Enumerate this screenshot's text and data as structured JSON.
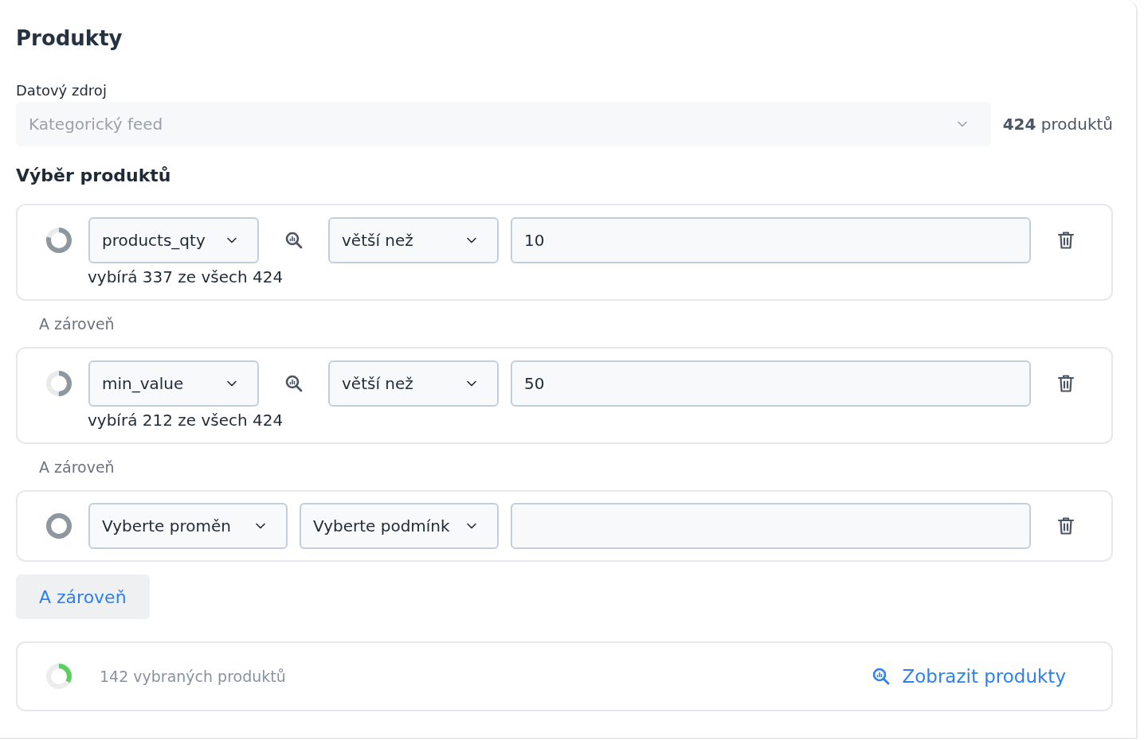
{
  "title": "Produkty",
  "data_source": {
    "label": "Datový zdroj",
    "placeholder": "Kategorický feed",
    "count": "**424** produktů"
  },
  "selection": {
    "heading": "Výběr produktů",
    "conditions": [
      {
        "kind": "defined",
        "level": 0.79,
        "variable": "products_qty",
        "operator": "větší než",
        "value": "10",
        "summary": "vybírá 337 ze všech 424"
      },
      {
        "kind": "defined",
        "level": 0.5,
        "variable": "min_value",
        "operator": "větší než",
        "value": "50",
        "summary": "vybírá 212 ze všech 424"
      },
      {
        "kind": "new",
        "level": 1,
        "variable": "Vyberte proměn",
        "operator": "Vyberte podmínk"
      }
    ],
    "connectors": [
      "A zároveň",
      "A zároveň"
    ],
    "add_button": "A zároveň"
  },
  "result": {
    "level": 0.335,
    "label": "142 vybraných produktů",
    "link": "Zobrazit produkty"
  }
}
